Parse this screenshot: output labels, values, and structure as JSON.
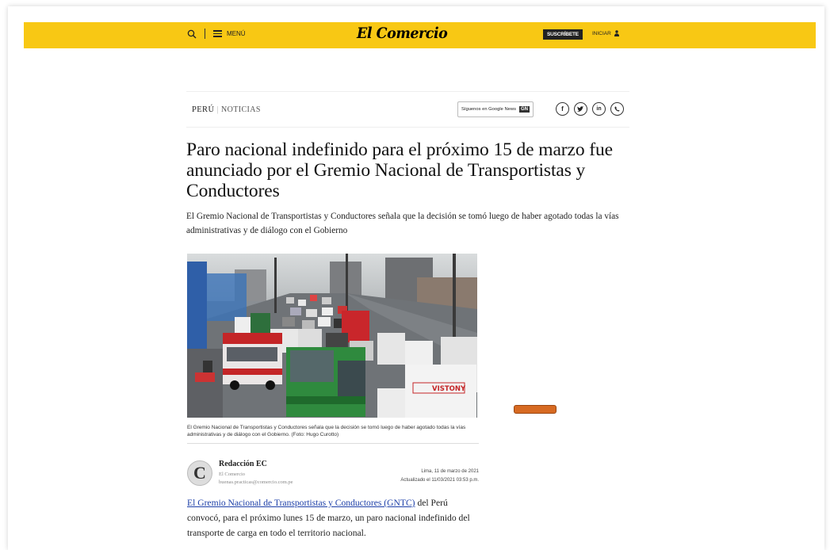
{
  "header": {
    "menu_label": "MENÚ",
    "logo": "El Comercio",
    "subscribe_label": "SUSCRÍBETE",
    "login_label": "INICIAR",
    "brand_color": "#f8c814"
  },
  "section": {
    "category": "PERÚ",
    "subcategory": "NOTICIAS",
    "google_news_label": "Síguenos en Google News",
    "google_news_badge": "GN",
    "share_icons": [
      "facebook-icon",
      "twitter-icon",
      "linkedin-icon",
      "whatsapp-icon"
    ],
    "share_glyphs": [
      "f",
      "t",
      "in",
      "w"
    ]
  },
  "article": {
    "headline": "Paro nacional indefinido para el próximo 15 de marzo fue anunciado por el Gremio Nacional de Transportistas y Conductores",
    "subheadline": "El Gremio Nacional de Transportistas y Conductores señala que la decisión se tomó luego de haber agotado todas la vías administrativas y de diálogo con el Gobierno",
    "photo_caption": "El Gremio Nacional de Transportistas y Conductores señala que la decisión se tomó luego de haber agotado todas la vías administrativas y de diálogo con el Gobierno. (Foto: Hugo Curotto)",
    "author_initial": "C",
    "author_name": "Redacción EC",
    "author_org": "El Comercio",
    "author_email": "buenas.practicas@comercio.com.pe",
    "published": "Lima, 11 de marzo de 2021",
    "updated": "Actualizado el 11/03/2021 03:53 p.m.",
    "body_link": "El Gremio Nacional de Transportistas y Conductores (GNTC)",
    "body_rest": " del Perú convocó, para el próximo lunes 15 de marzo, un paro nacional indefinido del transporte de carga en todo el territorio nacional.",
    "photo_bus_sign": "VISTONY"
  }
}
